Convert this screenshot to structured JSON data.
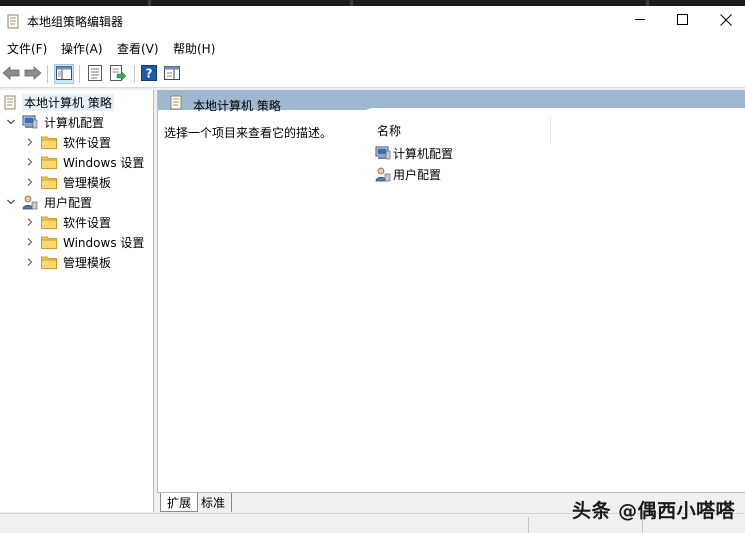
{
  "window": {
    "title": "本地组策略编辑器"
  },
  "menu": [
    {
      "label": "文件(F)"
    },
    {
      "label": "操作(A)"
    },
    {
      "label": "查看(V)"
    },
    {
      "label": "帮助(H)"
    }
  ],
  "toolbar": {
    "icons": [
      "back-arrow-icon",
      "forward-arrow-icon",
      "show-hide-tree-icon",
      "properties-icon",
      "export-list-icon",
      "help-icon",
      "show-hide-action-pane-icon"
    ]
  },
  "tree": {
    "root": "本地计算机 策略",
    "computer_config": "计算机配置",
    "computer_children": [
      "软件设置",
      "Windows 设置",
      "管理模板"
    ],
    "user_config": "用户配置",
    "user_children": [
      "软件设置",
      "Windows 设置",
      "管理模板"
    ]
  },
  "main": {
    "header_title": "本地计算机 策略",
    "description": "选择一个项目来查看它的描述。",
    "column_name": "名称",
    "items": [
      "计算机配置",
      "用户配置"
    ]
  },
  "tabs": {
    "extended": "扩展",
    "standard": "标准"
  },
  "watermark": "头条 @偶西小嗒嗒",
  "colors": {
    "header_bar": "#9fb8cf",
    "selection": "#e5f1fb",
    "folder": "#f5c54a",
    "help_blue": "#1f5aa8"
  }
}
